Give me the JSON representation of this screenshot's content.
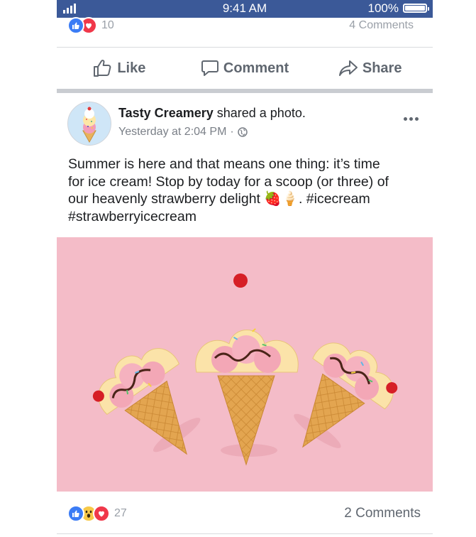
{
  "status_bar": {
    "time": "9:41 AM",
    "battery": "100%"
  },
  "previous_post": {
    "reaction_count": "10",
    "comments": "4 Comments"
  },
  "actions": {
    "like": "Like",
    "comment": "Comment",
    "share": "Share"
  },
  "post": {
    "author": "Tasty Creamery",
    "action_text": " shared a photo.",
    "timestamp": "Yesterday at 2:04 PM",
    "separator": "·",
    "text_lines": [
      "Summer is here and that means one thing: it’s time",
      "for ice cream! Stop by today for a scoop (or three) of",
      "our heavenly strawberry delight 🍓🍦. #icecream",
      "#strawberryicecream"
    ],
    "reaction_count": "27",
    "comments": "2 Comments"
  },
  "colors": {
    "brand_blue": "#3b5998",
    "like_blue": "#3b7cf5",
    "love_red": "#f0384a",
    "photo_background": "#f4bcc8"
  },
  "icons": [
    "signal-icon",
    "battery-icon",
    "like-reaction-icon",
    "love-reaction-icon",
    "wow-reaction-icon",
    "thumbs-up-icon",
    "comment-icon",
    "share-icon",
    "globe-icon",
    "more-icon"
  ]
}
